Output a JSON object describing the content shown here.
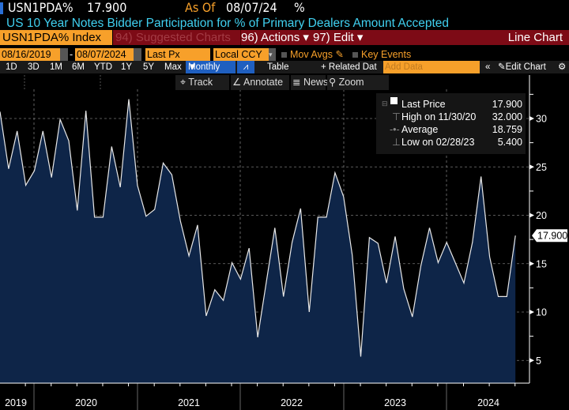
{
  "header": {
    "ticker": "USN1PDA%",
    "last_value": "17.900",
    "as_of_label": "As Of",
    "as_of_date": "08/07/24",
    "unit": "%",
    "title": "US 10 Year Notes Bidder Participation for % of Primary Dealers Amount Accepted"
  },
  "menubar": {
    "security": "USN1PDA% Index",
    "suggested": "94) Suggested Charts",
    "actions": "96) Actions",
    "edit": "97) Edit",
    "chart_type": "Line Chart"
  },
  "controls": {
    "start_date": "08/16/2019",
    "end_date": "08/07/2024",
    "field": "Last Px",
    "currency": "Local CCY",
    "mov_avgs": "Mov Avgs",
    "key_events": "Key Events"
  },
  "periods": [
    "1D",
    "3D",
    "1M",
    "6M",
    "YTD",
    "1Y",
    "5Y",
    "Max"
  ],
  "period_bar": {
    "frequency": "Monthly",
    "table": "Table",
    "related": "+ Related Dat",
    "add_data_placeholder": "Add Data",
    "edit_chart": "Edit Chart"
  },
  "tools": {
    "track": "Track",
    "annotate": "Annotate",
    "news": "News",
    "zoom": "Zoom"
  },
  "legend": {
    "last_label": "Last Price",
    "last_value": "17.900",
    "high_label": "High on 11/30/20",
    "high_value": "32.000",
    "avg_label": "Average",
    "avg_value": "18.759",
    "low_label": "Low on 02/28/23",
    "low_value": "5.400"
  },
  "colors": {
    "fill": "#0e2548",
    "line": "#e8e8e8",
    "orange": "#f7a02a",
    "red": "#7d0b16",
    "cyan": "#40d0f0"
  },
  "chart_data": {
    "type": "area",
    "title": "US 10 Year Notes Bidder Participation for % of Primary Dealers Amount Accepted",
    "frequency": "monthly",
    "start": "2019-08",
    "end": "2024-08",
    "values": [
      30.7,
      24.8,
      28.7,
      23.1,
      24.6,
      28.7,
      23.9,
      29.9,
      27.7,
      20.5,
      30.8,
      19.8,
      19.8,
      27.1,
      22.9,
      32.0,
      23.1,
      19.9,
      20.6,
      25.4,
      24.2,
      19.4,
      15.8,
      19.0,
      9.6,
      12.3,
      11.2,
      15.1,
      13.4,
      16.6,
      7.4,
      13.1,
      18.7,
      11.6,
      17.2,
      20.7,
      10.0,
      19.8,
      19.8,
      24.4,
      21.9,
      15.9,
      5.4,
      17.7,
      17.1,
      13.0,
      17.8,
      12.4,
      9.5,
      14.8,
      18.7,
      15.1,
      17.2,
      15.1,
      13.0,
      17.2,
      24.0,
      15.7,
      11.6,
      11.6,
      17.9
    ],
    "yticks": [
      "5",
      "10",
      "15",
      "20",
      "25",
      "30"
    ],
    "ylim": [
      2,
      34
    ],
    "xticks": [
      "2019",
      "2020",
      "2021",
      "2022",
      "2023",
      "2024"
    ],
    "last_price_label": "17.900",
    "grid": true
  }
}
